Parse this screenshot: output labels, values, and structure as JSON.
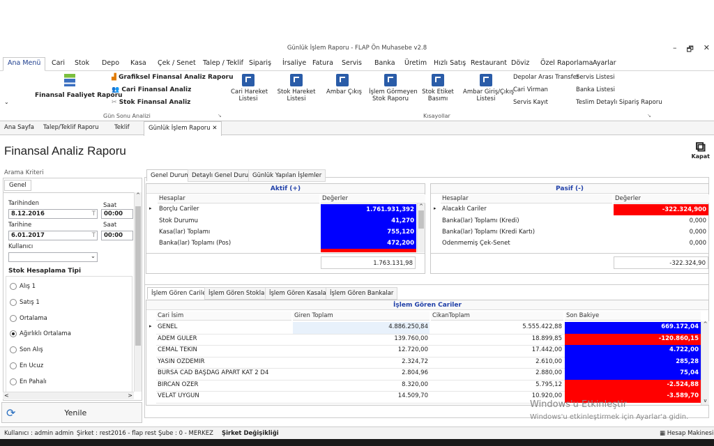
{
  "window": {
    "title": "Günlük İşlem Raporu - FLAP Ön Muhasebe v2.8",
    "minimize": "–",
    "restore": "🗗",
    "close": "✕"
  },
  "menu": [
    "Ana Menü",
    "Cari",
    "Stok",
    "Depo",
    "Kasa",
    "Çek / Senet",
    "Talep / Teklif",
    "Sipariş",
    "İrsaliye",
    "Fatura",
    "Servis",
    "Banka",
    "Üretim",
    "Hızlı Satış",
    "Restaurant",
    "Döviz",
    "Özel Raporlama",
    "Ayarlar"
  ],
  "ribbon": {
    "faaliyet": "Finansal Faaliyet Raporu",
    "grafiksel": "Grafiksel Finansal Analiz Raporu",
    "cari_fin": "Cari Finansal Analiz",
    "stok_fin": "Stok Finansal Analiz",
    "gun_sonu": "Gün Sonu Analizi",
    "cari_hareket": "Cari Hareket",
    "cari_hareket2": "Listesi",
    "stok_hareket": "Stok Hareket",
    "stok_hareket2": "Listesi",
    "ambar_cikis": "Ambar Çıkış",
    "islem_gormeyen": "İşlem Görmeyen",
    "islem_gormeyen2": "Stok Raporu",
    "stok_etiket": "Stok Etiket",
    "stok_etiket2": "Basımı",
    "ambar_giris": "Ambar Giriş/Çıkış",
    "ambar_giris2": "Listesi",
    "kisayollar": "Kısayollar",
    "depolar": "Depolar Arası Transfer",
    "cari_virman": "Cari Virman",
    "servis_kayit": "Servis Kayıt",
    "servis_listesi": "Servis Listesi",
    "banka_listesi": "Banka Listesi",
    "teslim": "Teslim Detaylı Sipariş Raporu"
  },
  "doctabs": [
    "Ana Sayfa",
    "Talep/Teklif Raporu",
    "Teklif",
    "Günlük İşlem Raporu"
  ],
  "doctab_close": "✕",
  "page_title": "Finansal Analiz Raporu",
  "kapat": "Kapat",
  "left": {
    "arama": "Arama Kriteri",
    "genel": "Genel",
    "tarihinden": "Tarihinden",
    "saat1": "Saat",
    "date1": "8.12.2016",
    "time1": "00:00",
    "tarihine": "Tarihine",
    "saat2": "Saat",
    "date2": "6.01.2017",
    "time2": "00:00",
    "kullanici": "Kullanıcı",
    "cal": "T",
    "stok_tipi": "Stok Hesaplama Tipi",
    "options": [
      "Alış 1",
      "Satış 1",
      "Ortalama",
      "Ağırlıklı Ortalama",
      "Son Alış",
      "En Ucuz",
      "En Pahalı"
    ],
    "selected": "Ağırlıklı Ortalama",
    "yenile": "Yenile"
  },
  "tabs1": [
    "Genel Durum",
    "Detaylı Genel Durum",
    "Günlük Yapılan İşlemler"
  ],
  "aktif": {
    "title": "Aktif (+)",
    "col1": "Hesaplar",
    "col2": "Değerler",
    "rows": [
      {
        "name": "Borçlu Cariler",
        "value": "1.761.931,392"
      },
      {
        "name": "Stok Durumu",
        "value": "41,270"
      },
      {
        "name": "Kasa(lar) Toplamı",
        "value": "755,120"
      },
      {
        "name": "Banka(lar) Toplamı (Pos)",
        "value": "472,200"
      }
    ],
    "total": "1.763.131,98"
  },
  "pasif": {
    "title": "Pasif (-)",
    "col1": "Hesaplar",
    "col2": "Değerler",
    "rows": [
      {
        "name": "Alacaklı Cariler",
        "value": "-322.324,900"
      },
      {
        "name": "Banka(lar) Toplamı (Kredi)",
        "value": "0,000"
      },
      {
        "name": "Banka(lar) Toplamı (Kredi Kartı)",
        "value": "0,000"
      },
      {
        "name": "Ödenmemiş Çek-Senet",
        "value": "0,000"
      }
    ],
    "total": "-322.324,90"
  },
  "tabs2": [
    "İşlem Gören Cariler",
    "İşlem Gören Stoklar",
    "İşlem Gören Kasalar",
    "İşlem Gören Bankalar"
  ],
  "cariler": {
    "title": "İşlem Gören Cariler",
    "cols": [
      "Cari İsim",
      "Giren Toplam",
      "CikanToplam",
      "Son Bakiye"
    ],
    "rows": [
      {
        "name": "GENEL",
        "giren": "4.886.250,84",
        "cikan": "5.555.422,88",
        "bakiye": "669.172,04",
        "neg": false
      },
      {
        "name": "ADEM GÜLER",
        "giren": "139.760,00",
        "cikan": "18.899,85",
        "bakiye": "-120.860,15",
        "neg": true
      },
      {
        "name": "CEMAL TEKİN",
        "giren": "12.720,00",
        "cikan": "17.442,00",
        "bakiye": "4.722,00",
        "neg": false
      },
      {
        "name": "YASİN ÖZDEMİR",
        "giren": "2.324,72",
        "cikan": "2.610,00",
        "bakiye": "285,28",
        "neg": false
      },
      {
        "name": "BURSA CAD BAŞDAĞ APART KAT 2 D4",
        "giren": "2.804,96",
        "cikan": "2.880,00",
        "bakiye": "75,04",
        "neg": false
      },
      {
        "name": "BİRCAN ÖZER",
        "giren": "8.320,00",
        "cikan": "5.795,12",
        "bakiye": "-2.524,88",
        "neg": true
      },
      {
        "name": "VELAT UYĞUN",
        "giren": "14.509,70",
        "cikan": "10.920,00",
        "bakiye": "-3.589,70",
        "neg": true
      }
    ]
  },
  "status": {
    "kullanici": "Kullanıcı : admin admin",
    "sirket": "Şirket : rest2016 - flap rest",
    "sube": "Şube : 0 - MERKEZ",
    "degisiklik": "Şirket Değişikliği",
    "hesap": "Hesap Makinesi"
  },
  "watermark": {
    "line1": "Windows'u Etkinleştir",
    "line2": "Windows'u etkinleştirmek için Ayarlar'a gidin."
  },
  "colors": {
    "blue": "#0000ff",
    "red": "#ff0000",
    "accent": "#2a5ca8"
  }
}
